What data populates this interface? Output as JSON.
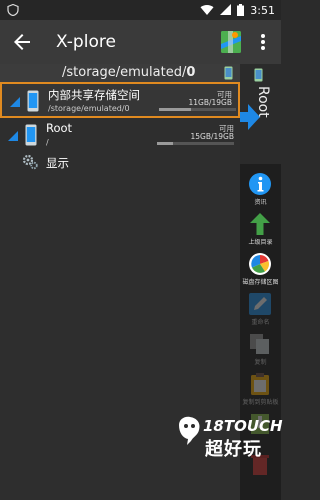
{
  "status_bar": {
    "time": "3:51",
    "icons": [
      "shield-icon",
      "wifi-icon",
      "signal-icon",
      "battery-icon"
    ]
  },
  "app_bar": {
    "title": "X-plore",
    "back_icon": "back-arrow-icon",
    "map_icon": "map-icon",
    "menu_icon": "more-vert-icon"
  },
  "pane": {
    "path_prefix": "/storage/emulated/",
    "path_last": "0",
    "items": [
      {
        "name": "内部共享存储空间",
        "sub": "/storage/emulated/0",
        "avail_label": "可用",
        "size": "11GB/19GB",
        "usage": 0.42,
        "selected": true
      },
      {
        "name": "Root",
        "sub": "/",
        "avail_label": "可用",
        "size": "15GB/19GB",
        "usage": 0.21,
        "selected": false
      }
    ],
    "settings_label": "显示"
  },
  "right_panel": {
    "root_label": "Root",
    "tools": [
      {
        "label": "资讯",
        "icon": "info-icon",
        "enabled": true
      },
      {
        "label": "上级目录",
        "icon": "up-arrow-icon",
        "enabled": true
      },
      {
        "label": "磁盘存储区图",
        "icon": "pie-chart-icon",
        "enabled": true
      },
      {
        "label": "重命名",
        "icon": "rename-icon",
        "enabled": false
      },
      {
        "label": "复制",
        "icon": "copy-icon",
        "enabled": false
      },
      {
        "label": "复制到剪贴板",
        "icon": "clipboard-icon",
        "enabled": false
      },
      {
        "label": "",
        "icon": "zip-icon",
        "enabled": false
      },
      {
        "label": "",
        "icon": "delete-icon",
        "enabled": false
      }
    ]
  },
  "watermark": {
    "text": "18TOUCH",
    "cn": "超好玩"
  },
  "colors": {
    "accent": "#1e88e5",
    "selection_border": "#e08a20",
    "background": "#2e2e2e",
    "toolbar": "#1e1e1e"
  }
}
